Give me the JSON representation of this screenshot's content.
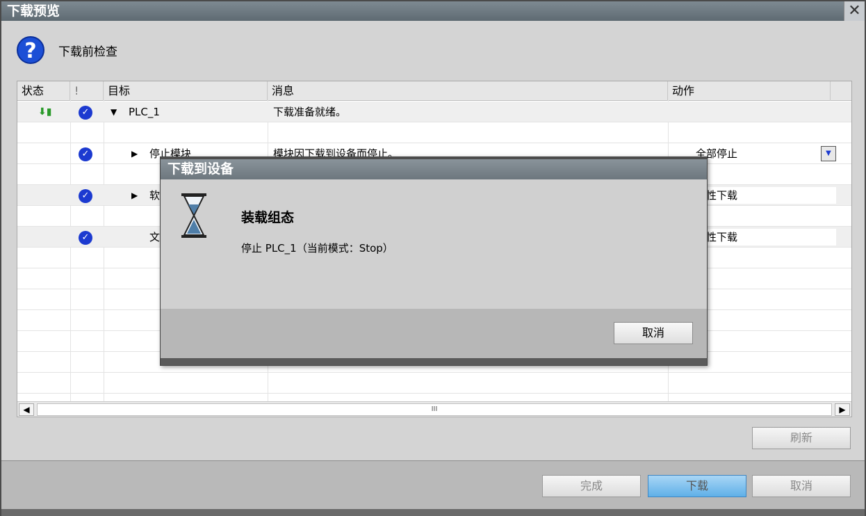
{
  "window": {
    "title": "下载预览",
    "close_glyph": "✕"
  },
  "header": {
    "label": "下载前检查",
    "icon": "question-icon"
  },
  "table": {
    "columns": [
      "状态",
      "!",
      "目标",
      "消息",
      "动作"
    ],
    "rows": [
      {
        "status_icon": "download-status-icon",
        "target": "PLC_1",
        "message": "下载准备就绪。",
        "action": ""
      },
      {
        "target": "停止模块",
        "message": "模块因下载到设备而停止。",
        "action": "全部停止"
      },
      {
        "target": "软",
        "message": "",
        "action": "致性下载"
      },
      {
        "target": "文",
        "message": "",
        "action": "致性下载"
      }
    ],
    "scroll_thumb_glyph": "III"
  },
  "buttons": {
    "refresh": "刷新",
    "finish": "完成",
    "download": "下载",
    "cancel": "取消"
  },
  "modal": {
    "title": "下载到设备",
    "heading": "装载组态",
    "status": "停止 PLC_1（当前模式：Stop）",
    "cancel": "取消",
    "icon": "hourglass-icon"
  },
  "colors": {
    "check": "#1c3ad0",
    "help": "#1c4fd6",
    "download_accent": "#5fb0e8"
  }
}
